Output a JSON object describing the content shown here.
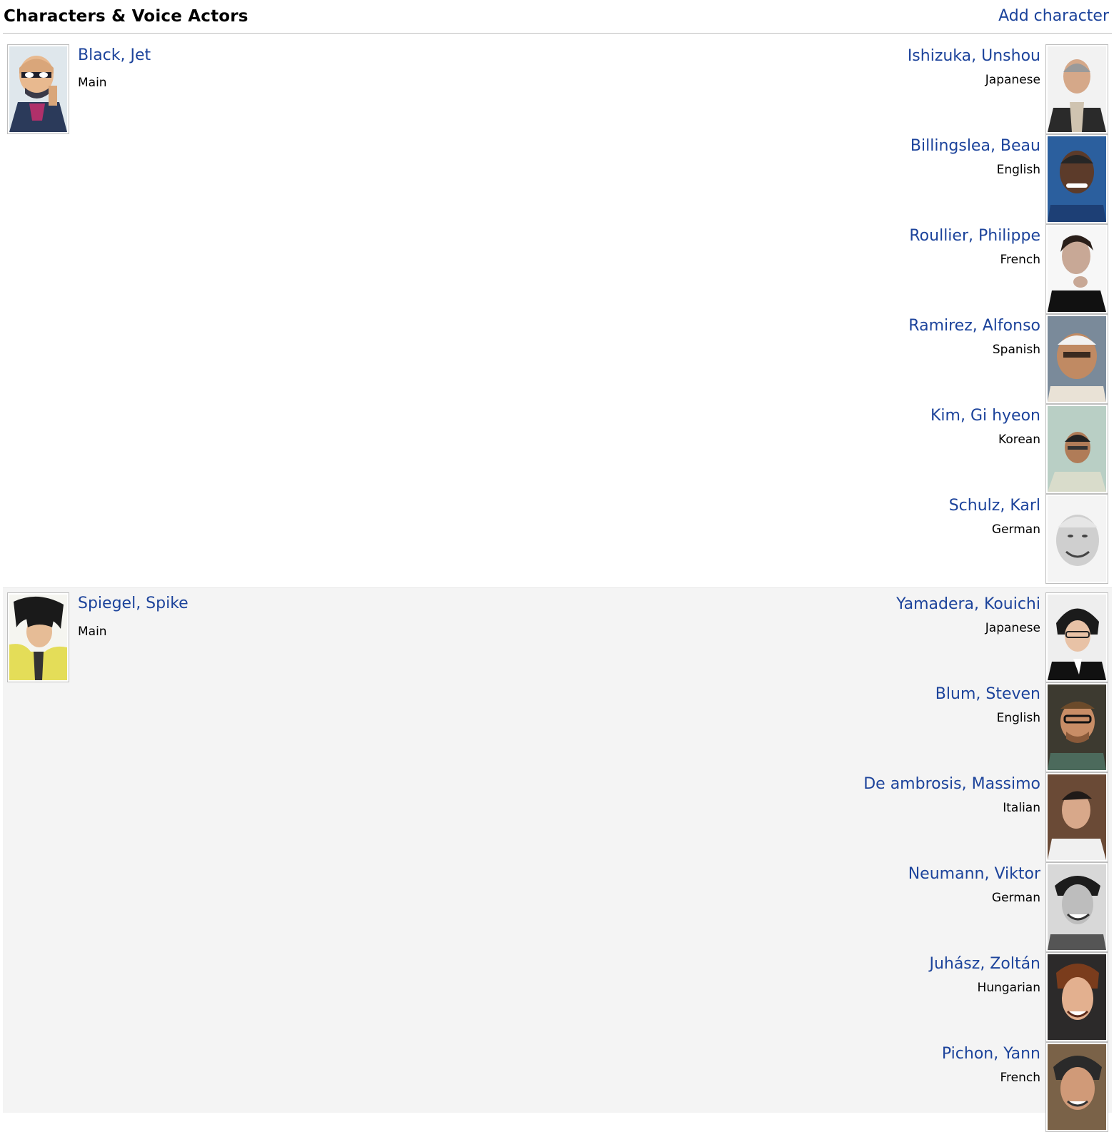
{
  "header": {
    "title": "Characters & Voice Actors",
    "add_link": "Add character"
  },
  "characters": [
    {
      "name": "Black, Jet",
      "role": "Main",
      "voice_actors": [
        {
          "name": "Ishizuka, Unshou",
          "language": "Japanese"
        },
        {
          "name": "Billingslea, Beau",
          "language": "English"
        },
        {
          "name": "Roullier, Philippe",
          "language": "French"
        },
        {
          "name": "Ramirez, Alfonso",
          "language": "Spanish"
        },
        {
          "name": "Kim, Gi hyeon",
          "language": "Korean"
        },
        {
          "name": "Schulz, Karl",
          "language": "German"
        }
      ]
    },
    {
      "name": "Spiegel, Spike",
      "role": "Main",
      "voice_actors": [
        {
          "name": "Yamadera, Kouichi",
          "language": "Japanese"
        },
        {
          "name": "Blum, Steven",
          "language": "English"
        },
        {
          "name": "De ambrosis, Massimo",
          "language": "Italian"
        },
        {
          "name": "Neumann, Viktor",
          "language": "German"
        },
        {
          "name": "Juhász, Zoltán",
          "language": "Hungarian"
        },
        {
          "name": "Pichon, Yann",
          "language": "French"
        }
      ]
    }
  ],
  "colors": {
    "link": "#1c439b",
    "alt_row_bg": "#f4f4f4",
    "border": "#bebebe"
  }
}
